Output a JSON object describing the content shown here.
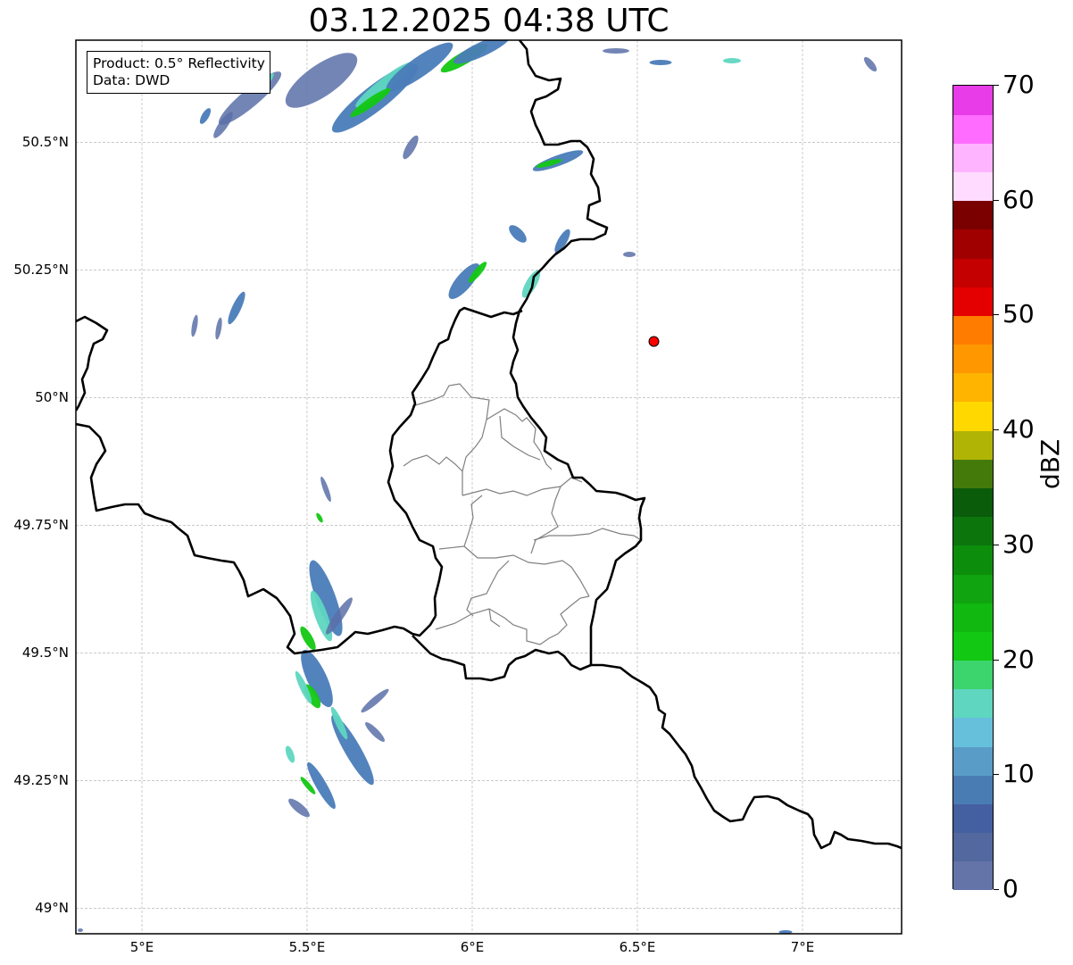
{
  "title": "03.12.2025 04:38 UTC",
  "info": {
    "product": "Product: 0.5° Reflectivity",
    "source": "Data: DWD"
  },
  "map": {
    "lon_range": [
      4.8,
      7.3
    ],
    "lat_range": [
      48.95,
      50.7
    ],
    "lat_ticks": [
      {
        "value": 50.5,
        "label": "50.5°N"
      },
      {
        "value": 50.25,
        "label": "50.25°N"
      },
      {
        "value": 50.0,
        "label": "50°N"
      },
      {
        "value": 49.75,
        "label": "49.75°N"
      },
      {
        "value": 49.5,
        "label": "49.5°N"
      },
      {
        "value": 49.25,
        "label": "49.25°N"
      },
      {
        "value": 49.0,
        "label": "49°N"
      }
    ],
    "lon_ticks": [
      {
        "value": 5.0,
        "label": "5°E"
      },
      {
        "value": 5.5,
        "label": "5.5°E"
      },
      {
        "value": 6.0,
        "label": "6°E"
      },
      {
        "value": 6.5,
        "label": "6.5°E"
      },
      {
        "value": 7.0,
        "label": "7°E"
      }
    ],
    "gridlines": true,
    "radar_site": {
      "lon": 6.55,
      "lat": 50.11,
      "color": "#ff0000"
    },
    "boundary_color": "#000000",
    "admin_color": "#808080"
  },
  "colorbar": {
    "label": "dBZ",
    "min": 0,
    "max": 70,
    "step": 2.5,
    "ticks": [
      0,
      10,
      20,
      30,
      40,
      50,
      60,
      70
    ],
    "colors": [
      "#6474a8",
      "#5468a0",
      "#4460a0",
      "#4a7cb4",
      "#5a9cc8",
      "#66c0dc",
      "#5ed6c0",
      "#3cd46c",
      "#12c812",
      "#10b810",
      "#10a410",
      "#0c8e0c",
      "#0c760c",
      "#0a5c0a",
      "#447a0a",
      "#b0b404",
      "#ffd800",
      "#ffb400",
      "#ff9800",
      "#ff7c00",
      "#e40000",
      "#c40000",
      "#a00000",
      "#7a0000",
      "#ffdcff",
      "#ffb4ff",
      "#ff6cff",
      "#e83ce8"
    ]
  },
  "echo_colors": {
    "low": "#5a70a8",
    "mid": "#4a7cb8",
    "light": "#5ed6c0",
    "green": "#12c812"
  }
}
